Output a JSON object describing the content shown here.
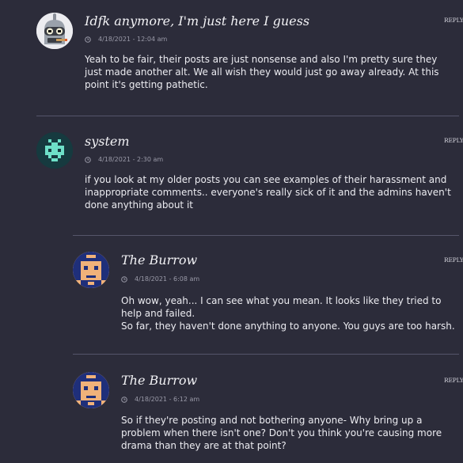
{
  "comments": [
    {
      "author": "Idfk anymore, I'm just here I guess",
      "timestamp": "4/18/2021 - 12:04 am",
      "reply_label": "REPLY",
      "avatar_icon": "robot-avatar-icon",
      "body": [
        "Yeah to be fair, their posts are just nonsense and also I'm pretty sure they just made another alt. We all wish they would just go away already. At this point it's getting pathetic."
      ]
    },
    {
      "author": "system",
      "timestamp": "4/18/2021 - 2:30 am",
      "reply_label": "REPLY",
      "avatar_icon": "pixel-invader-avatar-icon",
      "body": [
        "if you look at my older posts you can see examples of their harassment and inappropriate comments.. everyone's really sick of it and the admins haven't done anything about it"
      ]
    },
    {
      "author": "The Burrow",
      "timestamp": "4/18/2021 - 6:08 am",
      "reply_label": "REPLY",
      "avatar_icon": "pixel-face-avatar-icon",
      "body": [
        "Oh wow, yeah... I can see what you mean. It looks like they tried to help and failed.",
        "So far, they haven't done anything to anyone. You guys are too harsh."
      ]
    },
    {
      "author": "The Burrow",
      "timestamp": "4/18/2021 - 6:12 am",
      "reply_label": "REPLY",
      "avatar_icon": "pixel-face-avatar-icon",
      "body": [
        "So if they're posting and not bothering anyone- Why bring up a problem when there isn't one? Don't you think you're causing more drama than they are at that point?"
      ]
    }
  ],
  "colors": {
    "background": "#2c2c3a",
    "text": "#ececf1",
    "meta": "#9a9aa8",
    "divider": "#55556a"
  }
}
